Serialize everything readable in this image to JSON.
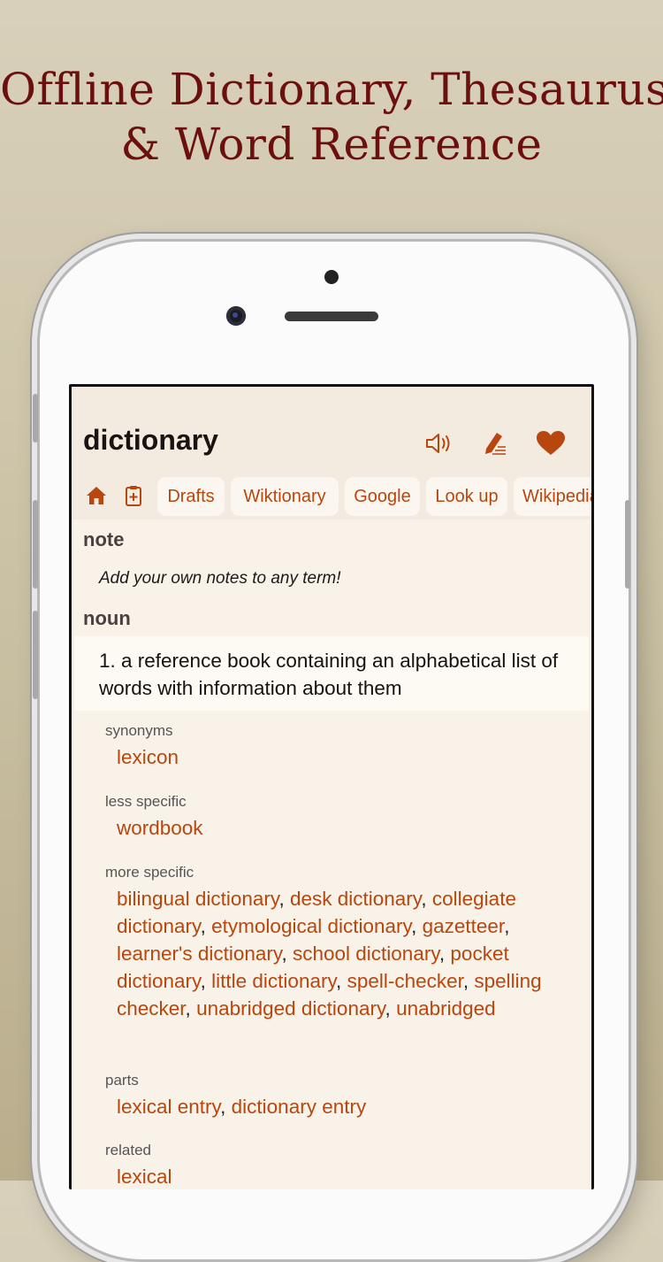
{
  "headline": {
    "line1": "Offline Dictionary, Thesaurus",
    "line2": "& Word Reference"
  },
  "app": {
    "word": "dictionary",
    "icons": [
      "speaker-icon",
      "edit-pencil-icon",
      "heart-icon",
      "home-icon",
      "clipboard-add-icon"
    ],
    "tabs": [
      "Drafts",
      "Wiktionary",
      "Google",
      "Look up",
      "Wikipedia"
    ],
    "note": {
      "heading": "note",
      "text": "Add your own notes to any term!"
    },
    "pos": "noun",
    "definition": "1. a reference book containing an alphabetical list of words with information about them",
    "relations": [
      {
        "label": "synonyms",
        "words": [
          "lexicon"
        ]
      },
      {
        "label": "less specific",
        "words": [
          "wordbook"
        ]
      },
      {
        "label": "more specific",
        "words": [
          "bilingual dictionary",
          "desk dictionary",
          "collegiate dictionary",
          "etymological dictionary",
          "gazetteer",
          "learner's dictionary",
          "school dictionary",
          "pocket dictionary",
          "little dictionary",
          "spell-checker",
          "spelling checker",
          "unabridged dictionary",
          "unabridged"
        ]
      },
      {
        "label": "parts",
        "words": [
          "lexical entry",
          "dictionary entry"
        ]
      },
      {
        "label": "related",
        "words": [
          "lexical"
        ]
      }
    ]
  },
  "colors": {
    "accent": "#b8460f",
    "headline": "#6b0f0f",
    "background": "#f8f2e8"
  }
}
